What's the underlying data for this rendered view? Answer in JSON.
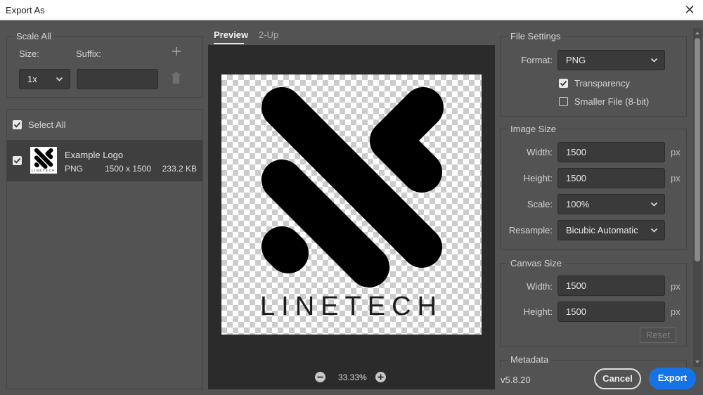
{
  "window": {
    "title": "Export As"
  },
  "scale_all": {
    "title": "Scale All",
    "size_label": "Size:",
    "suffix_label": "Suffix:",
    "size_value": "1x",
    "suffix_value": ""
  },
  "assets": {
    "select_all_label": "Select All",
    "items": [
      {
        "name": "Example Logo",
        "format": "PNG",
        "dimensions": "1500 x 1500",
        "size": "233.2 KB",
        "checked": true
      }
    ]
  },
  "tabs": [
    {
      "label": "Preview",
      "active": true
    },
    {
      "label": "2-Up",
      "active": false
    }
  ],
  "preview": {
    "logo_text": "LINETECH",
    "zoom": "33.33%"
  },
  "file_settings": {
    "title": "File Settings",
    "format_label": "Format:",
    "format_value": "PNG",
    "transparency_label": "Transparency",
    "transparency_checked": true,
    "smaller_file_label": "Smaller File (8-bit)",
    "smaller_file_checked": false
  },
  "image_size": {
    "title": "Image Size",
    "width_label": "Width:",
    "width_value": "1500",
    "height_label": "Height:",
    "height_value": "1500",
    "unit": "px",
    "scale_label": "Scale:",
    "scale_value": "100%",
    "resample_label": "Resample:",
    "resample_value": "Bicubic Automatic"
  },
  "canvas_size": {
    "title": "Canvas Size",
    "width_label": "Width:",
    "width_value": "1500",
    "height_label": "Height:",
    "height_value": "1500",
    "unit": "px",
    "reset_label": "Reset"
  },
  "metadata": {
    "title": "Metadata"
  },
  "footer": {
    "version": "v5.8.20",
    "cancel_label": "Cancel",
    "export_label": "Export"
  },
  "colors": {
    "dialog_bg": "#535353",
    "field_bg": "#3a3a3a",
    "preview_bg": "#2b2b2b",
    "selected_row": "#3f3f3f",
    "accent": "#1473e6"
  },
  "icons": [
    "close-icon",
    "add-icon",
    "trash-icon",
    "chevron-down-icon",
    "checkmark-icon",
    "zoom-out-icon",
    "zoom-in-icon"
  ]
}
